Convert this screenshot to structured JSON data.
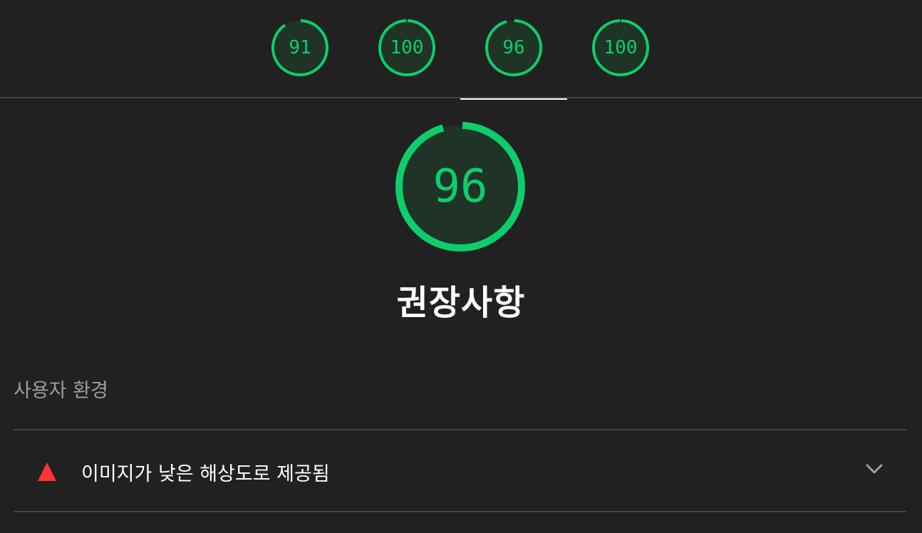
{
  "tabs": [
    {
      "score": "91",
      "value": 91
    },
    {
      "score": "100",
      "value": 100
    },
    {
      "score": "96",
      "value": 96
    },
    {
      "score": "100",
      "value": 100
    }
  ],
  "active_tab_index": 2,
  "category": {
    "score": "96",
    "value": 96,
    "title": "권장사항"
  },
  "group": {
    "title": "사용자 환경"
  },
  "audits": [
    {
      "title": "이미지가 낮은 해상도로 제공됨",
      "status_icon": "warning-triangle-icon",
      "expand_icon": "chevron-down-icon"
    }
  ],
  "colors": {
    "pass": "#0cce6b",
    "pass_fill": "#1f3327",
    "warn": "#ff3333",
    "background": "#212121"
  }
}
